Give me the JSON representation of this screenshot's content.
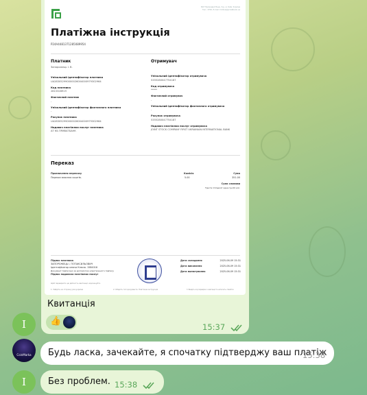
{
  "document": {
    "brand_icon": "privatbank-logo-icon",
    "header_meta": [
      "ВАТ Промінвестбанк, б-р, м. Київ, Україна",
      "Тел.: 3700, Е-mail: hotline@privatbank.ua"
    ],
    "title": "Платіжна інструкція",
    "number": "P24A4481371285089954",
    "payer": {
      "heading": "Платник",
      "name": "Запорожець І. В.",
      "fields": [
        {
          "label": "Унікальний ідентифікатор платника",
          "value": "UA283052990000026004000979302964"
        },
        {
          "label": "Код платника",
          "value": "2815328919"
        },
        {
          "label": "Фактичний платник",
          "value": "-"
        },
        {
          "label": "Унікальний ідентифікатор фактичного платника",
          "value": "-"
        },
        {
          "label": "Рахунок платника",
          "value": "UA283052990000026004000979302964"
        },
        {
          "label": "Надавач платіжних послуг платника",
          "value": "АТ КБ ПРИВАТБАНК"
        }
      ]
    },
    "recipient": {
      "heading": "Отримувач",
      "fields": [
        {
          "label": "Унікальний ідентифікатор отримувача",
          "value": "5355280047754187"
        },
        {
          "label": "Код отримувача",
          "value": "*****"
        },
        {
          "label": "Фактичний отримувач",
          "value": "-"
        },
        {
          "label": "Унікальний ідентифікатор фактичного отримувача",
          "value": "-"
        },
        {
          "label": "Рахунок отримувача",
          "value": "5355280047754187"
        },
        {
          "label": "Надавач платіжних послуг отримувача",
          "value": "JOINT STOCK COMPANY FIRST UKRAINIAN INTERNATIONAL BANK"
        }
      ]
    },
    "transfer": {
      "heading": "Переказ",
      "purpose_label": "Призначення переказу",
      "purpose_value": "Переказ власних коштів.",
      "commission_label": "Комісія",
      "commission_value": "5.00",
      "amount_label": "Сума",
      "amount_value": "351.00",
      "amount_words_label": "Сума словами",
      "amount_words_value": "Триста п'ятдесят одна грн 00 коп."
    },
    "signatures": {
      "lines": [
        "Підпис платника",
        "ЗАПОРОЖЕЦЬ І. ПОТАКСИЛЬОВИЧ",
        "Ідентифікатор ключа Ключа. 1584016",
        "Документ підписано за допомогою електронного підпису",
        "Підпис надавача платіжних послуг"
      ],
      "dates": [
        {
          "label": "Дата складання",
          "value": "2025-06-09 15:31"
        },
        {
          "label": "Дата виконання",
          "value": "2025-06-09 15:31"
        },
        {
          "label": "Дата валютування",
          "value": "2025-06-09 15:31"
        }
      ],
      "note": "Щоб перевірити цю дійсність квитанції, відскануйте",
      "steps": [
        "1. Зайдіть на сторінку раз.україна",
        "2. Оберіть тип документа: Платіжна інструкція",
        "3. Введіть код перевірки з квитанції та натисніть «Знайти»"
      ]
    }
  },
  "messages": [
    {
      "id": "m1",
      "caption": "Квитанція",
      "time": "15:37",
      "reaction_emoji": "👍",
      "status_icon": "double-check-icon"
    },
    {
      "id": "m2",
      "text": "Будь ласка, зачекайте, я спочатку підтверджу ваш платіж",
      "time": "15:38",
      "sender_avatar_text": "CoinMarka"
    },
    {
      "id": "m3",
      "text": "Без проблем.",
      "time": "15:38",
      "status_icon": "double-check-icon"
    }
  ],
  "user_avatar_letter": "I",
  "colors": {
    "accent": "#5aa75a",
    "out_bubble": "#e8f5d8",
    "privat_green": "#3aa047",
    "avatar_green": "#7bc25a"
  }
}
